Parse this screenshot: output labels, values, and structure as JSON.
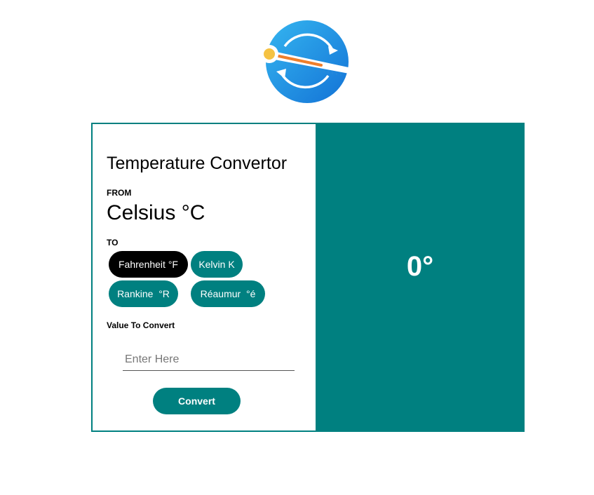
{
  "logo": {
    "icon": "thermometer-refresh-logo",
    "colors": {
      "circle": "#1E8FE0",
      "arrows": "#ffffff",
      "mercury": "#F07F2B",
      "bulb": "#F5C242"
    }
  },
  "converter": {
    "title": "Temperature Convertor",
    "from_label": "FROM",
    "from_unit": "Celsius °C",
    "to_label": "TO",
    "units": [
      {
        "label": "Fahrenheit °F",
        "active": true
      },
      {
        "label": "Kelvin K",
        "active": false
      },
      {
        "label": "Rankine  °R",
        "active": false
      },
      {
        "label": "Réaumur  °é",
        "active": false
      }
    ],
    "value_label": "Value To Convert",
    "input_placeholder": "Enter Here",
    "input_value": "",
    "convert_label": "Convert",
    "result": "0°"
  },
  "colors": {
    "accent": "#008080",
    "active_unit": "#000000"
  }
}
